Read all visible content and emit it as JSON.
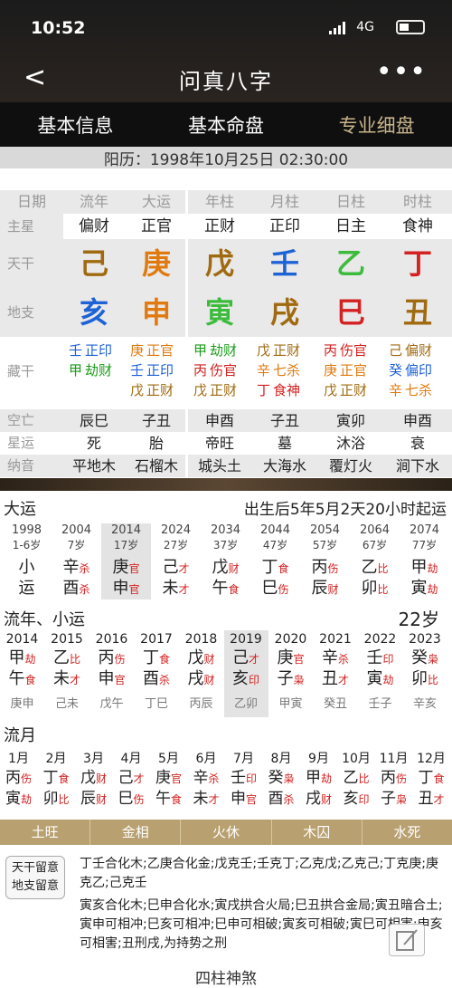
{
  "status": {
    "time": "10:52",
    "network": "4G"
  },
  "nav": {
    "back": "<",
    "title": "问真八字",
    "more": "•••"
  },
  "tabs": [
    "基本信息",
    "基本命盘",
    "专业细盘"
  ],
  "solar": "阳历：1998年10月25日 02:30:00",
  "head": [
    "日期",
    "流年",
    "大运",
    "年柱",
    "月柱",
    "日柱",
    "时柱"
  ],
  "zhuxing": {
    "label": "主星",
    "v": [
      "偏财",
      "正官",
      "正财",
      "正印",
      "日主",
      "食神"
    ]
  },
  "tiangan": {
    "label": "天干",
    "v": [
      "己",
      "庚",
      "戊",
      "壬",
      "乙",
      "丁"
    ],
    "c": [
      "#a06a10",
      "#e07a10",
      "#a06a10",
      "#1e63d6",
      "#3dbb3d",
      "#d42121"
    ]
  },
  "dizhi": {
    "label": "地支",
    "v": [
      "亥",
      "申",
      "寅",
      "戌",
      "巳",
      "丑"
    ],
    "c": [
      "#1e63d6",
      "#e07a10",
      "#3dbb3d",
      "#a06a10",
      "#d42121",
      "#a06a10"
    ]
  },
  "canggan": {
    "label": "藏干",
    "cols": [
      [
        {
          "t": "壬",
          "r": "正印",
          "c": "#1e63d6"
        },
        {
          "t": "甲",
          "r": "劫财",
          "c": "#1a9c1a"
        }
      ],
      [
        {
          "t": "庚",
          "r": "正官",
          "c": "#e07a10"
        },
        {
          "t": "壬",
          "r": "正印",
          "c": "#1e63d6"
        },
        {
          "t": "戊",
          "r": "正财",
          "c": "#a06a10"
        }
      ],
      [
        {
          "t": "甲",
          "r": "劫财",
          "c": "#1a9c1a"
        },
        {
          "t": "丙",
          "r": "伤官",
          "c": "#d42121"
        },
        {
          "t": "戊",
          "r": "正财",
          "c": "#a06a10"
        }
      ],
      [
        {
          "t": "戊",
          "r": "正财",
          "c": "#a06a10"
        },
        {
          "t": "辛",
          "r": "七杀",
          "c": "#e07a10"
        },
        {
          "t": "丁",
          "r": "食神",
          "c": "#d42121"
        }
      ],
      [
        {
          "t": "丙",
          "r": "伤官",
          "c": "#d42121"
        },
        {
          "t": "庚",
          "r": "正官",
          "c": "#e07a10"
        },
        {
          "t": "戊",
          "r": "正财",
          "c": "#a06a10"
        }
      ],
      [
        {
          "t": "己",
          "r": "偏财",
          "c": "#a06a10"
        },
        {
          "t": "癸",
          "r": "偏印",
          "c": "#1e63d6"
        },
        {
          "t": "辛",
          "r": "七杀",
          "c": "#e07a10"
        }
      ]
    ]
  },
  "kongwang": {
    "label": "空亡",
    "v": [
      "辰巳",
      "子丑",
      "申酉",
      "子丑",
      "寅卯",
      "申酉"
    ]
  },
  "xingyun": {
    "label": "星运",
    "v": [
      "死",
      "胎",
      "帝旺",
      "墓",
      "沐浴",
      "衰"
    ]
  },
  "nayin": {
    "label": "纳音",
    "v": [
      "平地木",
      "石榴木",
      "城头土",
      "大海水",
      "覆灯火",
      "涧下水"
    ]
  },
  "dayun": {
    "title": "大运",
    "start": "出生后5年5月2天20小时起运",
    "items": [
      {
        "y": "1998",
        "a": "1-6岁",
        "g": "小",
        "z": "运",
        "gs": "",
        "zs": ""
      },
      {
        "y": "2004",
        "a": "7岁",
        "g": "辛",
        "z": "酉",
        "gs": "杀",
        "zs": "杀"
      },
      {
        "y": "2014",
        "a": "17岁",
        "g": "庚",
        "z": "申",
        "gs": "官",
        "zs": "官"
      },
      {
        "y": "2024",
        "a": "27岁",
        "g": "己",
        "z": "未",
        "gs": "才",
        "zs": "才"
      },
      {
        "y": "2034",
        "a": "37岁",
        "g": "戊",
        "z": "午",
        "gs": "财",
        "zs": "食"
      },
      {
        "y": "2044",
        "a": "47岁",
        "g": "丁",
        "z": "巳",
        "gs": "食",
        "zs": "伤"
      },
      {
        "y": "2054",
        "a": "57岁",
        "g": "丙",
        "z": "辰",
        "gs": "伤",
        "zs": "财"
      },
      {
        "y": "2064",
        "a": "67岁",
        "g": "乙",
        "z": "卯",
        "gs": "比",
        "zs": "比"
      },
      {
        "y": "2074",
        "a": "77岁",
        "g": "甲",
        "z": "寅",
        "gs": "劫",
        "zs": "劫"
      }
    ]
  },
  "liunian": {
    "title": "流年、小运",
    "age": "22岁",
    "items": [
      {
        "y": "2014",
        "g": "甲",
        "z": "午",
        "gs": "劫",
        "zs": "食",
        "x": "庚申"
      },
      {
        "y": "2015",
        "g": "乙",
        "z": "未",
        "gs": "比",
        "zs": "才",
        "x": "己未"
      },
      {
        "y": "2016",
        "g": "丙",
        "z": "申",
        "gs": "伤",
        "zs": "官",
        "x": "戊午"
      },
      {
        "y": "2017",
        "g": "丁",
        "z": "酉",
        "gs": "食",
        "zs": "杀",
        "x": "丁巳"
      },
      {
        "y": "2018",
        "g": "戊",
        "z": "戌",
        "gs": "财",
        "zs": "财",
        "x": "丙辰"
      },
      {
        "y": "2019",
        "g": "己",
        "z": "亥",
        "gs": "才",
        "zs": "印",
        "x": "乙卯"
      },
      {
        "y": "2020",
        "g": "庚",
        "z": "子",
        "gs": "官",
        "zs": "枭",
        "x": "甲寅"
      },
      {
        "y": "2021",
        "g": "辛",
        "z": "丑",
        "gs": "杀",
        "zs": "才",
        "x": "癸丑"
      },
      {
        "y": "2022",
        "g": "壬",
        "z": "寅",
        "gs": "印",
        "zs": "劫",
        "x": "壬子"
      },
      {
        "y": "2023",
        "g": "癸",
        "z": "卯",
        "gs": "枭",
        "zs": "比",
        "x": "辛亥"
      }
    ]
  },
  "liuyue": {
    "title": "流月",
    "items": [
      {
        "m": "1月",
        "g": "丙",
        "z": "寅",
        "gs": "伤",
        "zs": "劫"
      },
      {
        "m": "2月",
        "g": "丁",
        "z": "卯",
        "gs": "食",
        "zs": "比"
      },
      {
        "m": "3月",
        "g": "戊",
        "z": "辰",
        "gs": "财",
        "zs": "财"
      },
      {
        "m": "4月",
        "g": "己",
        "z": "巳",
        "gs": "才",
        "zs": "伤"
      },
      {
        "m": "5月",
        "g": "庚",
        "z": "午",
        "gs": "官",
        "zs": "食"
      },
      {
        "m": "6月",
        "g": "辛",
        "z": "未",
        "gs": "杀",
        "zs": "才"
      },
      {
        "m": "7月",
        "g": "壬",
        "z": "申",
        "gs": "印",
        "zs": "官"
      },
      {
        "m": "8月",
        "g": "癸",
        "z": "酉",
        "gs": "枭",
        "zs": "杀"
      },
      {
        "m": "9月",
        "g": "甲",
        "z": "戌",
        "gs": "劫",
        "zs": "财"
      },
      {
        "m": "10月",
        "g": "乙",
        "z": "亥",
        "gs": "比",
        "zs": "印"
      },
      {
        "m": "11月",
        "g": "丙",
        "z": "子",
        "gs": "伤",
        "zs": "枭"
      },
      {
        "m": "12月",
        "g": "丁",
        "z": "丑",
        "gs": "食",
        "zs": "才"
      }
    ]
  },
  "wuxing": [
    "土旺",
    "金相",
    "火休",
    "木囚",
    "水死"
  ],
  "analysis": {
    "badge1": "天干留意",
    "badge2": "地支留意",
    "tg": "丁壬合化木;乙庚合化金;戊克壬;壬克丁;乙克戊;乙克己;丁克庚;庚克乙;己克壬",
    "dz": "寅亥合化木;巳申合化水;寅戌拱合火局;巳丑拱合金局;寅丑暗合土;寅申可相冲;巳亥可相冲;巳申可相破;寅亥可相破;寅巳可相害;申亥可相害;丑刑戌,为持势之刑",
    "footer": "四柱神煞"
  }
}
